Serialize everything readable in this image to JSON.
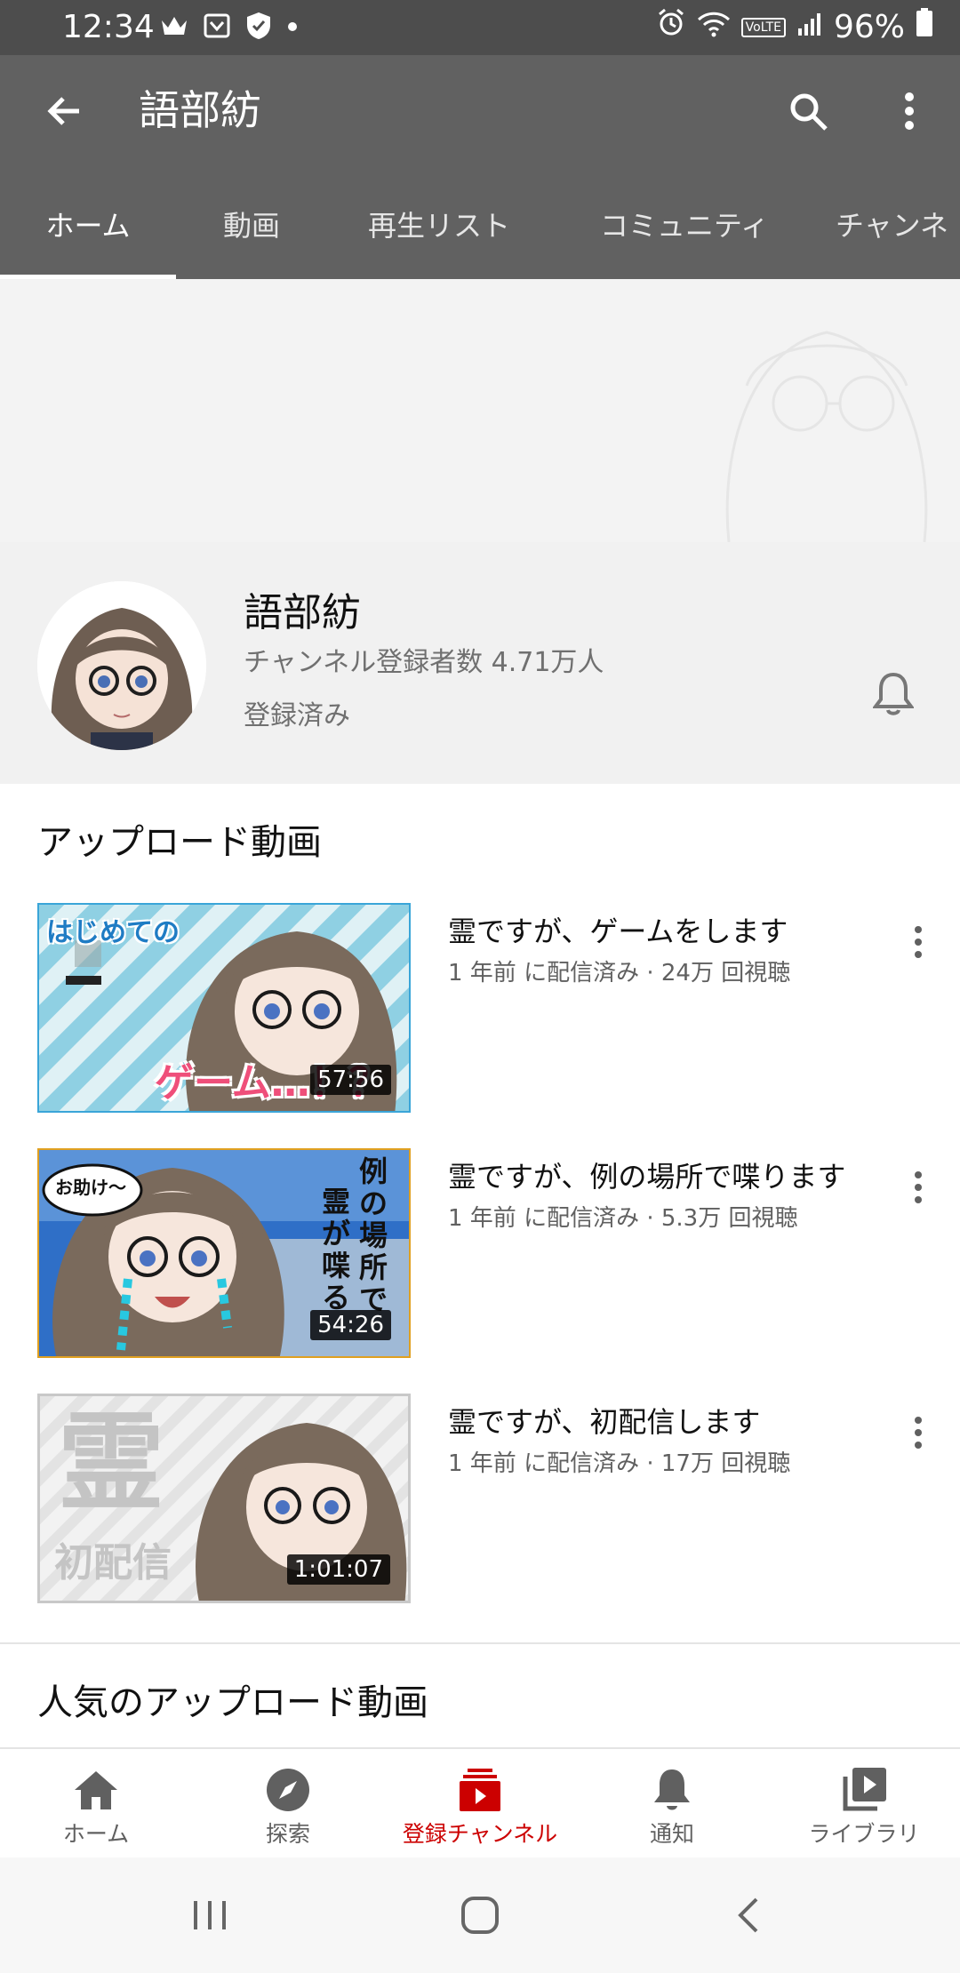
{
  "status_bar": {
    "time": "12:34",
    "battery": "96%",
    "icons_left": [
      "crown-icon",
      "cast-icon",
      "shield-icon",
      "dot-icon"
    ],
    "icons_right": [
      "alarm-icon",
      "wifi-icon",
      "volte-icon",
      "signal-icon",
      "battery-icon"
    ],
    "volte_label": "VoLTE"
  },
  "app_bar": {
    "title": "語部紡",
    "icons": [
      "back-arrow-icon",
      "search-icon",
      "more-vert-icon"
    ]
  },
  "tabs": [
    {
      "label": "ホーム",
      "active": true
    },
    {
      "label": "動画",
      "active": false
    },
    {
      "label": "再生リスト",
      "active": false
    },
    {
      "label": "コミュニティ",
      "active": false
    },
    {
      "label": "チャンネ",
      "active": false
    }
  ],
  "channel": {
    "name": "語部紡",
    "subscribers": "チャンネル登録者数 4.71万人",
    "status": "登録済み",
    "bell_icon": "bell-icon"
  },
  "uploads": {
    "section_title": "アップロード動画",
    "videos": [
      {
        "title": "霊ですが、ゲームをします",
        "meta": "1 年前 に配信済み · 24万 回視聴",
        "duration": "57:56",
        "thumb_text_top": "はじめての",
        "thumb_text_bottom": "ゲーム…！？"
      },
      {
        "title": "霊ですが、例の場所で喋ります",
        "meta": "1 年前 に配信済み · 5.3万 回視聴",
        "duration": "54:26",
        "thumb_bubble": "お助け～",
        "thumb_vertical_1": "例の場所で",
        "thumb_vertical_2": "霊が喋る"
      },
      {
        "title": "霊ですが、初配信します",
        "meta": "1 年前 に配信済み · 17万 回視聴",
        "duration": "1:01:07",
        "thumb_big_char": "霊",
        "thumb_sub_text": "初配信"
      }
    ]
  },
  "popular": {
    "section_title": "人気のアップロード動画"
  },
  "bottom_nav": [
    {
      "label": "ホーム",
      "icon": "home-icon",
      "active": false
    },
    {
      "label": "探索",
      "icon": "compass-icon",
      "active": false
    },
    {
      "label": "登録チャンネル",
      "icon": "subscriptions-icon",
      "active": true
    },
    {
      "label": "通知",
      "icon": "bell-icon",
      "active": false
    },
    {
      "label": "ライブラリ",
      "icon": "library-icon",
      "active": false
    }
  ],
  "system_nav": [
    "recents-icon",
    "home-circle-icon",
    "back-chevron-icon"
  ],
  "colors": {
    "app_bar": "#616161",
    "status_bar": "#4d4d4d",
    "active_nav": "#cc0000",
    "channel_header_bg": "#f1f1f1"
  }
}
